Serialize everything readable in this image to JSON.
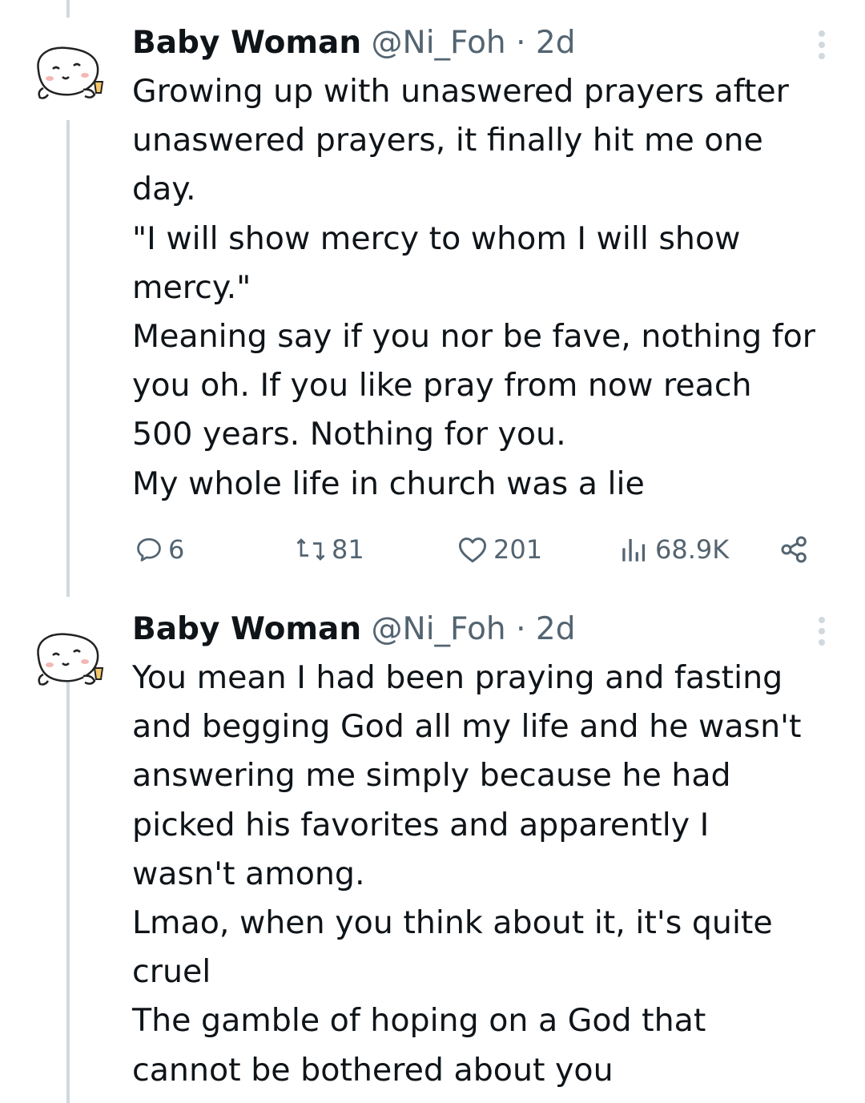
{
  "colors": {
    "text": "#0f1419",
    "secondary": "#536471",
    "thread_line": "#cfd9de"
  },
  "tweets": [
    {
      "author_name": "Baby Woman",
      "handle": "@Ni_Foh",
      "separator": "·",
      "time": "2d",
      "lines": [
        "Growing up with unaswered prayers after",
        "unaswered prayers, it finally hit me one",
        "day.",
        "\"I will show mercy to whom I will show",
        "mercy.\"",
        "Meaning say if you nor be fave, nothing for",
        "you oh. If you like pray from now reach",
        "500 years. Nothing for you.",
        "My whole life in church was a lie"
      ],
      "actions": {
        "replies": "6",
        "reposts": "81",
        "likes": "201",
        "views": "68.9K"
      },
      "icons": [
        "avatar-icon",
        "more-icon",
        "reply-icon",
        "repost-icon",
        "like-icon",
        "views-icon",
        "share-icon"
      ]
    },
    {
      "author_name": "Baby Woman",
      "handle": "@Ni_Foh",
      "separator": "·",
      "time": "2d",
      "lines": [
        "You mean I had been praying and fasting",
        "and begging God all my life and he wasn't",
        "answering me simply because he had",
        "picked his favorites and apparently I",
        "wasn't among.",
        "Lmao, when you think about it, it's quite",
        "cruel",
        "The gamble of hoping on a God that",
        "cannot be bothered about you"
      ],
      "icons": [
        "avatar-icon",
        "more-icon"
      ]
    }
  ]
}
